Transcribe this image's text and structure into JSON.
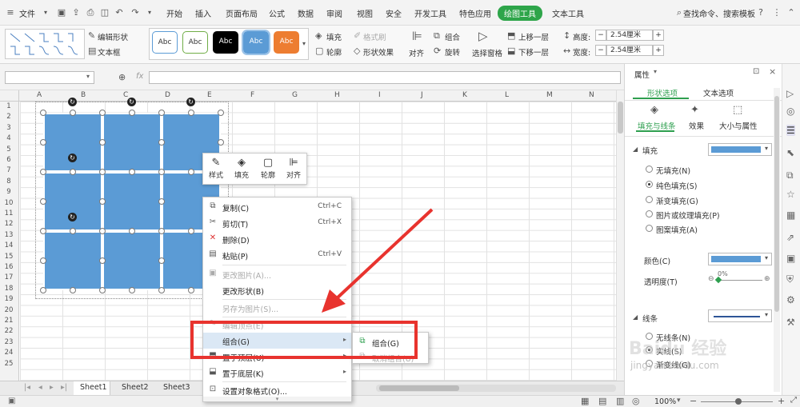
{
  "menubar": {
    "file": "文件",
    "tabs": [
      "开始",
      "插入",
      "页面布局",
      "公式",
      "数据",
      "审阅",
      "视图",
      "安全",
      "开发工具",
      "特色应用",
      "绘图工具",
      "文本工具"
    ],
    "active_tab": "绘图工具",
    "search": "查找命令、搜索模板"
  },
  "ribbon": {
    "edit_shape": "编辑形状",
    "text_box": "文本框",
    "styles": [
      "Abc",
      "Abc",
      "Abc",
      "Abc",
      "Abc"
    ],
    "fill": "填充",
    "format_brush": "格式刷",
    "outline": "轮廓",
    "shape_effect": "形状效果",
    "align": "对齐",
    "group": "组合",
    "rotate": "旋转",
    "selection_pane": "选择窗格",
    "bring_forward": "上移一层",
    "send_backward": "下移一层",
    "height_label": "高度:",
    "height_value": "2.54厘米",
    "width_label": "宽度:",
    "width_value": "2.54厘米"
  },
  "formula": {
    "fx": "fx"
  },
  "grid": {
    "columns": [
      "A",
      "B",
      "C",
      "D",
      "E",
      "F",
      "G",
      "H",
      "I",
      "J",
      "K",
      "L",
      "M",
      "N"
    ],
    "rows": [
      "1",
      "2",
      "3",
      "4",
      "5",
      "6",
      "7",
      "8",
      "9",
      "10",
      "11",
      "12",
      "13",
      "14",
      "15",
      "16",
      "17",
      "18",
      "19",
      "20",
      "21",
      "22",
      "23",
      "24",
      "25"
    ]
  },
  "sheets": [
    "Sheet1",
    "Sheet2",
    "Sheet3"
  ],
  "status": {
    "zoom": "100%"
  },
  "panel": {
    "title": "属性",
    "tab_shape": "形状选项",
    "tab_text": "文本选项",
    "sub_fill_line": "填充与线条",
    "sub_effect": "效果",
    "sub_size": "大小与属性",
    "fill_section": "填充",
    "fill_options": [
      "无填充(N)",
      "纯色填充(S)",
      "渐变填充(G)",
      "图片或纹理填充(P)",
      "图案填充(A)"
    ],
    "selected_fill": 1,
    "color_label": "颜色(C)",
    "transparency_label": "透明度(T)",
    "transparency_value": "0%",
    "line_section": "线条",
    "line_options": [
      "无线条(N)",
      "实线(S)",
      "渐变线(G)"
    ],
    "fill_color": "#5b9bd5",
    "line_color": "#2e5597"
  },
  "mini_toolbar": {
    "items": [
      "样式",
      "填充",
      "轮廓",
      "对齐"
    ]
  },
  "context_menu": {
    "items": [
      {
        "label": "复制(C)",
        "shortcut": "Ctrl+C"
      },
      {
        "label": "剪切(T)",
        "shortcut": "Ctrl+X"
      },
      {
        "label": "删除(D)",
        "shortcut": ""
      },
      {
        "label": "粘贴(P)",
        "shortcut": "Ctrl+V"
      },
      {
        "label": "更改图片(A)...",
        "shortcut": ""
      },
      {
        "label": "更改形状(B)",
        "shortcut": ""
      },
      {
        "label": "另存为图片(S)...",
        "shortcut": ""
      },
      {
        "label": "编辑顶点(E)",
        "shortcut": ""
      },
      {
        "label": "组合(G)",
        "shortcut": ""
      },
      {
        "label": "置于顶层(U)",
        "shortcut": ""
      },
      {
        "label": "置于底层(K)",
        "shortcut": ""
      },
      {
        "label": "设置对象格式(O)...",
        "shortcut": ""
      }
    ]
  },
  "submenu": {
    "items": [
      "组合(G)",
      "取消组合(U)"
    ]
  },
  "watermark": {
    "site": "jingyan.baidu.com",
    "logo_text": "Baidu 经验"
  }
}
